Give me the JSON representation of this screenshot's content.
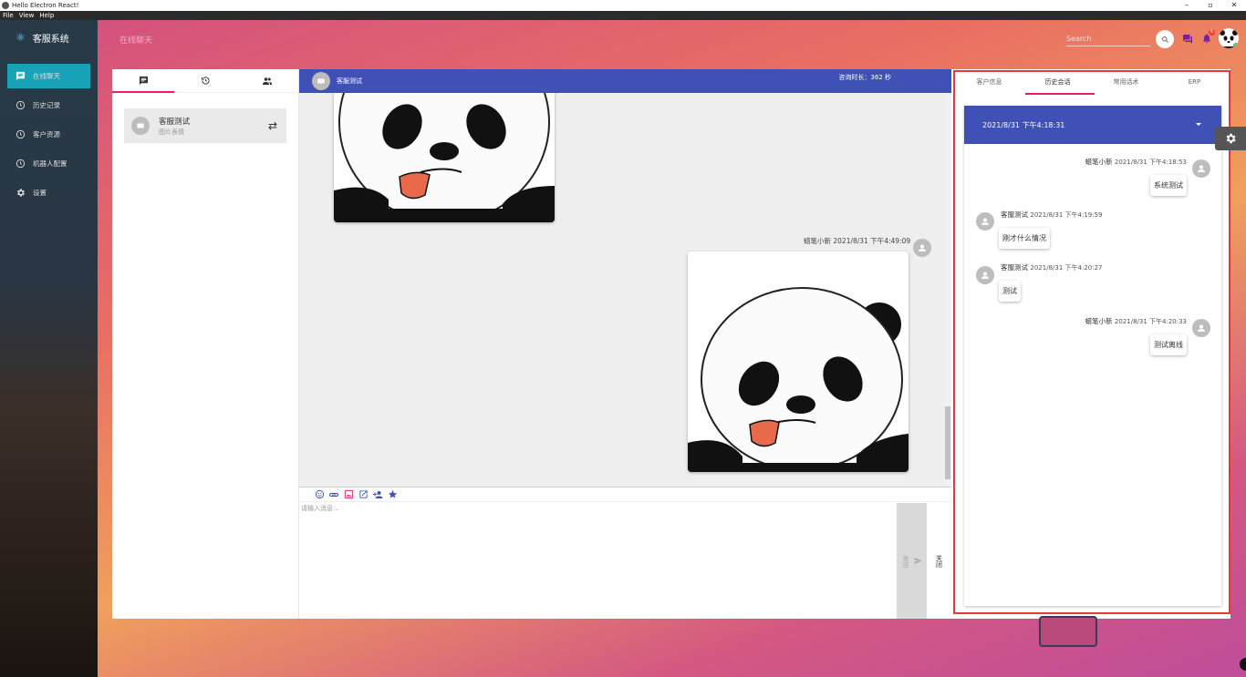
{
  "window": {
    "title": "Hello Electron React!",
    "controls": [
      "–",
      "▫",
      "✕"
    ]
  },
  "menu": [
    "File",
    "View",
    "Help"
  ],
  "sidebar": {
    "brand": "客服系统",
    "items": [
      {
        "label": "在线聊天",
        "icon": "chat-icon",
        "active": true
      },
      {
        "label": "历史记录",
        "icon": "clock-icon"
      },
      {
        "label": "客户资源",
        "icon": "clock-icon"
      },
      {
        "label": "机器人配置",
        "icon": "clock-icon"
      },
      {
        "label": "设置",
        "icon": "gear-icon"
      }
    ]
  },
  "topbar": {
    "page_title": "在线聊天",
    "search_placeholder": "Search",
    "badge_count": "6"
  },
  "left": {
    "tabs": [
      "chat-icon",
      "history-icon",
      "people-icon"
    ],
    "conversation": {
      "name": "客服测试",
      "subtitle": "图片表情"
    }
  },
  "chat": {
    "header_name": "客服测试",
    "header_duration": "咨询时长：362 秒",
    "message_sender": "蜡笔小新 2021/8/31 下午4:49:09",
    "composer_placeholder": "请输入消息...",
    "send_label": "发送",
    "close_label": "关闭",
    "toolbar_icons": [
      "emoji-icon",
      "attach-icon",
      "image-icon",
      "open-external-icon",
      "add-person-icon",
      "star-icon"
    ]
  },
  "right": {
    "tabs": [
      "客户信息",
      "历史会话",
      "常用话术",
      "ERP"
    ],
    "active_tab": "历史会话",
    "session_select": "2021/8/31 下午4:18:31",
    "history": [
      {
        "name": "蜡笔小新",
        "time": "2021/8/31 下午4:18:53",
        "text": "系统测试",
        "side": "right"
      },
      {
        "name": "客服测试",
        "time": "2021/8/31 下午4:19:59",
        "text": "刚才什么情况",
        "side": "left"
      },
      {
        "name": "客服测试",
        "time": "2021/8/31 下午4:20:27",
        "text": "测试",
        "side": "left"
      },
      {
        "name": "蜡笔小新",
        "time": "2021/8/31 下午4:20:33",
        "text": "测试离线",
        "side": "right"
      }
    ]
  },
  "colors": {
    "primary": "#3f51b5",
    "accent": "#e91e63",
    "active_nav": "#17a2b8",
    "highlight_border": "#e53935"
  }
}
